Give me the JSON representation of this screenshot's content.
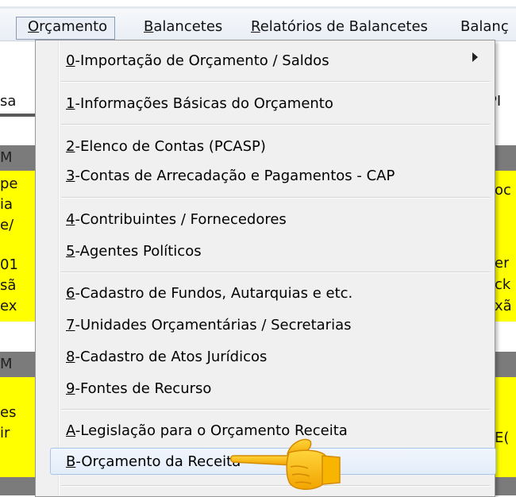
{
  "menubar": {
    "items": [
      {
        "label": "Orçamento",
        "accel": "O",
        "rest": "rçamento",
        "open": true
      },
      {
        "label": "Balancetes",
        "accel": "B",
        "rest": "alancetes"
      },
      {
        "label": "Relatórios de Balancetes",
        "accel": "R",
        "rest": "elatórios de Balancetes"
      },
      {
        "label": "Balanç",
        "accel": "",
        "rest": "Balanç"
      }
    ]
  },
  "left_fragments": [
    "sa",
    "M",
    "pe",
    "ia",
    "e/",
    "01",
    "sã",
    "ex",
    "M",
    "",
    "es",
    "ir"
  ],
  "right_fragments": [
    "PI",
    "oc",
    "er",
    "ck",
    "xã",
    "E("
  ],
  "menu": {
    "items": [
      {
        "key": "0",
        "text": "-Importação de Orçamento / Saldos",
        "submenu": true
      },
      {
        "key": "1",
        "text": "-Informações Básicas do Orçamento"
      },
      {
        "key": "2",
        "text": "-Elenco de Contas (PCASP)"
      },
      {
        "key": "3",
        "text": "-Contas de Arrecadação e Pagamentos - CAP"
      },
      {
        "key": "4",
        "text": "-Contribuintes / Fornecedores"
      },
      {
        "key": "5",
        "text": "-Agentes Políticos"
      },
      {
        "key": "6",
        "text": "-Cadastro de Fundos, Autarquias e etc."
      },
      {
        "key": "7",
        "text": "-Unidades Orçamentárias / Secretarias"
      },
      {
        "key": "8",
        "text": "-Cadastro de Atos Jurídicos"
      },
      {
        "key": "9",
        "text": "-Fontes de Recurso"
      },
      {
        "key": "A",
        "text": "-Legislação para o Orçamento Receita"
      },
      {
        "key": "B",
        "text": "-Orçamento da Receita",
        "highlighted": true
      }
    ]
  },
  "pointer_icon": "pointing-hand-icon",
  "colors": {
    "highlight_yellow": "#ffff00",
    "header_gray": "#7b7b7b",
    "menu_bg": "#f0f0f0"
  }
}
